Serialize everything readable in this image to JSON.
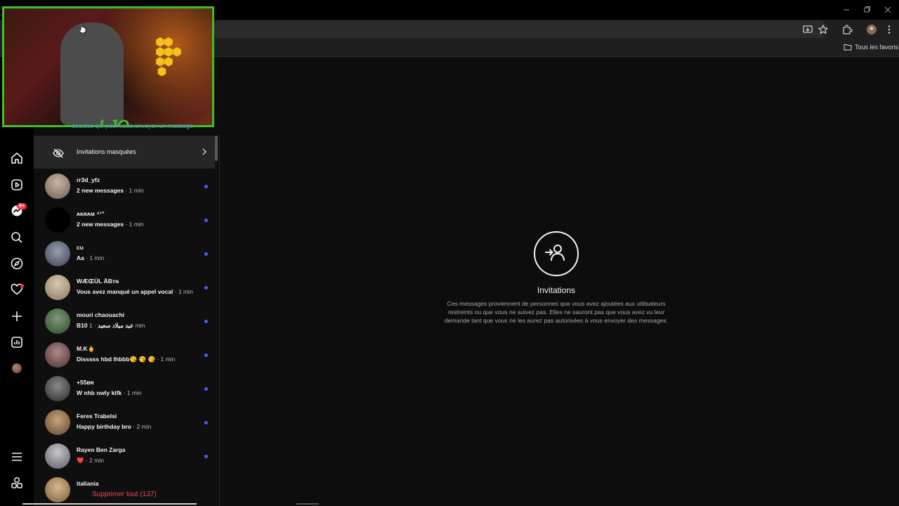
{
  "browser": {
    "bookmarks_folder": "Tous les favoris"
  },
  "rail": {
    "icons": [
      "home-icon",
      "reels-icon",
      "messages-icon",
      "search-icon",
      "explore-icon",
      "notifications-icon",
      "create-icon",
      "dashboard-icon",
      "profile-avatar",
      "menu-icon",
      "threads-icon"
    ],
    "messages_badge": "9+"
  },
  "webcam": {
    "watermark": "LJO"
  },
  "list": {
    "hidden_caption": "décidez qui peut vous envoyer un message",
    "hidden_invites_label": "Invitations masquées",
    "conversations": [
      {
        "name": "rr3d_yfz",
        "message": "2 new messages",
        "time": "· 1 min",
        "unread": true
      },
      {
        "name": "ᴀᴋʀᴀᴍ ⁴⁷°",
        "message": "2 new messages",
        "time": "· 1 min",
        "unread": true
      },
      {
        "name": "cu",
        "message": "Aa",
        "time": "· 1 min",
        "unread": true
      },
      {
        "name": "WÆŒÜL ÄBᴛɴ",
        "message": "Vous avez manqué un appel vocal",
        "time": "· 1 min",
        "unread": true
      },
      {
        "name": "mouri chaouachi",
        "message": "B10 عيد ميلاد سعيد",
        "time": "· 1 min",
        "unread": true
      },
      {
        "name": "M.K🖕",
        "message": "Disssss hbd lhbbb😘 😘 😘",
        "time": "· 1 min",
        "unread": true
      },
      {
        "name": "+55ʙʀ",
        "message": "W nhb nwly kifk",
        "time": "· 1 min",
        "unread": true
      },
      {
        "name": "Feres Trabelsi",
        "message": "Happy birthday bro",
        "time": "· 2 min",
        "unread": true
      },
      {
        "name": "Rayen Ben Zarga",
        "message": "❤️",
        "time": "· 2 min",
        "unread": true
      },
      {
        "name": "italiania",
        "message": "",
        "time": "",
        "unread": false
      }
    ],
    "delete_all": "Supprimer tout (137)"
  },
  "main": {
    "title": "Invitations",
    "description": "Ces messages proviennent de personnes que vous avez ajoutées aux utilisateurs restreints ou que vous ne suivez pas. Elles ne sauront pas que vous avez vu leur demande tant que vous ne les aurez pas autorisées à vous envoyer des messages."
  },
  "colors": {
    "accent_unread": "#4a5df9",
    "badge": "#ff3040",
    "danger_text": "#ed4956",
    "webcam_border": "#3fbf2c"
  }
}
